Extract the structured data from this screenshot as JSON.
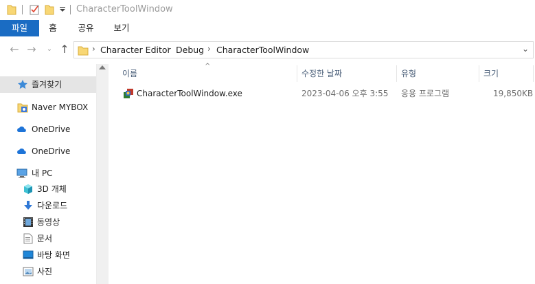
{
  "window": {
    "title": "CharacterToolWindow"
  },
  "ribbon": {
    "tabs": [
      {
        "label": "파일"
      },
      {
        "label": "홈"
      },
      {
        "label": "공유"
      },
      {
        "label": "보기"
      }
    ]
  },
  "address": {
    "crumbs": [
      {
        "label": "Character Editor"
      },
      {
        "label": "Debug"
      },
      {
        "label": "CharacterToolWindow"
      }
    ]
  },
  "nav_pane": {
    "items": [
      {
        "label": "즐겨찾기",
        "icon": "star-icon",
        "selected": true
      },
      {
        "label": "Naver MYBOX",
        "icon": "mybox-icon"
      },
      {
        "label": "OneDrive",
        "icon": "onedrive-icon"
      },
      {
        "label": "OneDrive",
        "icon": "onedrive-icon"
      },
      {
        "label": "내 PC",
        "icon": "pc-icon"
      },
      {
        "label": "3D 개체",
        "icon": "3d-objects-icon"
      },
      {
        "label": "다운로드",
        "icon": "download-icon"
      },
      {
        "label": "동영상",
        "icon": "video-icon"
      },
      {
        "label": "문서",
        "icon": "document-icon"
      },
      {
        "label": "바탕 화면",
        "icon": "desktop-icon"
      },
      {
        "label": "사진",
        "icon": "pictures-icon"
      }
    ]
  },
  "columns": {
    "name": "이름",
    "modified": "수정한 날짜",
    "type": "유형",
    "size": "크기"
  },
  "files": [
    {
      "name": "CharacterToolWindow.exe",
      "modified": "2023-04-06 오후 3:55",
      "type": "응용 프로그램",
      "size": "19,850KB",
      "icon": "exe-icon"
    }
  ],
  "colors": {
    "accent": "#1a6cc3",
    "folder": "#f8d775",
    "header_text": "#4c607a"
  }
}
